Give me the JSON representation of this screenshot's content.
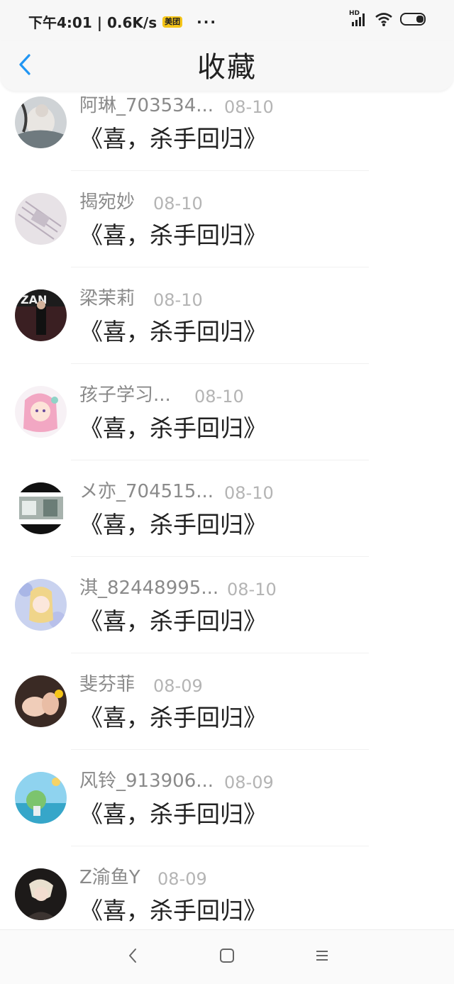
{
  "status_bar": {
    "time_speed": "下午4:01 | 0.6K/s",
    "app_badge": "美团",
    "overflow": "···",
    "network_label": "HD",
    "icons": [
      "signal-icon",
      "wifi-icon",
      "battery-icon"
    ]
  },
  "header": {
    "back_icon": "chevron-left-icon",
    "title": "收藏"
  },
  "favorites": [
    {
      "name": "阿琳_703534...",
      "date": "08-10",
      "title": "《喜，杀手回归》"
    },
    {
      "name": "揭宛妙",
      "date": "08-10",
      "title": "《喜，杀手回归》"
    },
    {
      "name": "梁茉莉",
      "date": "08-10",
      "title": "《喜，杀手回归》"
    },
    {
      "name": "孩子学习...",
      "date": "08-10",
      "title": "《喜，杀手回归》"
    },
    {
      "name": "メ亦_704515...",
      "date": "08-10",
      "title": "《喜，杀手回归》"
    },
    {
      "name": "淇_82448995...",
      "date": "08-10",
      "title": "《喜，杀手回归》"
    },
    {
      "name": "斐芬菲",
      "date": "08-09",
      "title": "《喜，杀手回归》"
    },
    {
      "name": "风铃_913906...",
      "date": "08-09",
      "title": "《喜，杀手回归》"
    },
    {
      "name": "Z渝鱼Y",
      "date": "08-09",
      "title": "《喜，杀手回归》"
    }
  ],
  "nav_bar": {
    "icons": [
      "back-nav-icon",
      "home-nav-icon",
      "menu-nav-icon"
    ]
  },
  "colors": {
    "accent": "#2196f3",
    "name_text": "#8a8a8a",
    "date_text": "#b4b4b4",
    "title_text": "#222222"
  }
}
